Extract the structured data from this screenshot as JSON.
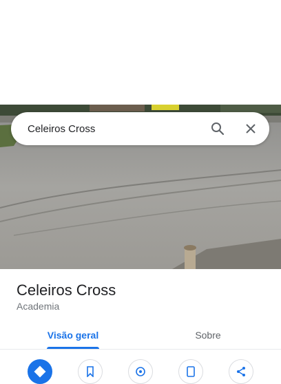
{
  "search": {
    "query": "Celeiros Cross"
  },
  "place": {
    "name": "Celeiros Cross",
    "category": "Academia"
  },
  "tabs": [
    {
      "label": "Visão geral",
      "selected": true
    },
    {
      "label": "Sobre",
      "selected": false
    }
  ],
  "actions": [
    {
      "icon": "directions-icon"
    },
    {
      "icon": "bookmark-icon"
    },
    {
      "icon": "nearby-icon"
    },
    {
      "icon": "send-to-phone-icon"
    },
    {
      "icon": "share-icon"
    }
  ],
  "colors": {
    "accent": "#1a73e8",
    "text": "#202124",
    "secondary_text": "#70757a"
  }
}
